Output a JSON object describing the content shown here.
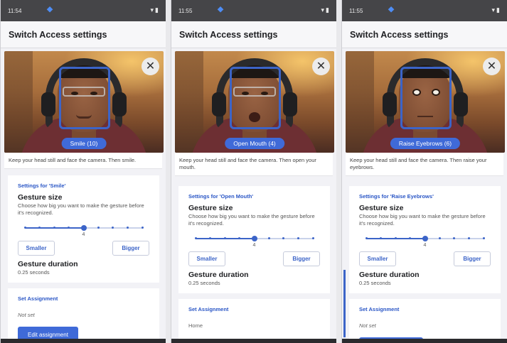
{
  "screens": [
    {
      "status_time": "11:54",
      "title": "Switch Access settings",
      "gesture_chip": "Smile (10)",
      "instruction": "Keep your head still and face the camera. Then smile.",
      "settings_heading": "Settings for 'Smile'",
      "gesture_size_label": "Gesture size",
      "gesture_size_desc": "Choose how big you want to make the gesture before it's recognized.",
      "slider_value": "4",
      "slider_level": 4,
      "slider_max": 8,
      "smaller_label": "Smaller",
      "bigger_label": "Bigger",
      "duration_label": "Gesture duration",
      "duration_value": "0.25 seconds",
      "assignment_heading": "Set Assignment",
      "assignment_value": "Not set",
      "edit_button": "Edit assignment"
    },
    {
      "status_time": "11:55",
      "title": "Switch Access settings",
      "gesture_chip": "Open Mouth (4)",
      "instruction": "Keep your head still and face the camera. Then open your mouth.",
      "settings_heading": "Settings for 'Open Mouth'",
      "gesture_size_label": "Gesture size",
      "gesture_size_desc": "Choose how big you want to make the gesture before it's recognized.",
      "slider_value": "4",
      "slider_level": 4,
      "slider_max": 8,
      "smaller_label": "Smaller",
      "bigger_label": "Bigger",
      "duration_label": "Gesture duration",
      "duration_value": "0.25 seconds",
      "assignment_heading": "Set Assignment",
      "assignment_value": "Home",
      "edit_button": ""
    },
    {
      "status_time": "11:55",
      "title": "Switch Access settings",
      "gesture_chip": "Raise Eyebrows (6)",
      "instruction": "Keep your head still and face the camera. Then raise your eyebrows.",
      "settings_heading": "Settings for 'Raise Eyebrows'",
      "gesture_size_label": "Gesture size",
      "gesture_size_desc": "Choose how big you want to make the gesture before it's recognized.",
      "slider_value": "4",
      "slider_level": 4,
      "slider_max": 8,
      "smaller_label": "Smaller",
      "bigger_label": "Bigger",
      "duration_label": "Gesture duration",
      "duration_value": "0.25 seconds",
      "assignment_heading": "Set Assignment",
      "assignment_value": "Not set",
      "edit_button": ""
    }
  ],
  "icons": {
    "app_icon": "switch-access-icon",
    "close": "close-icon",
    "status_system": "wifi-battery-icon"
  },
  "colors": {
    "accent": "#3f6ad8",
    "status_bar": "#454548",
    "background": "#f2f2f6"
  }
}
